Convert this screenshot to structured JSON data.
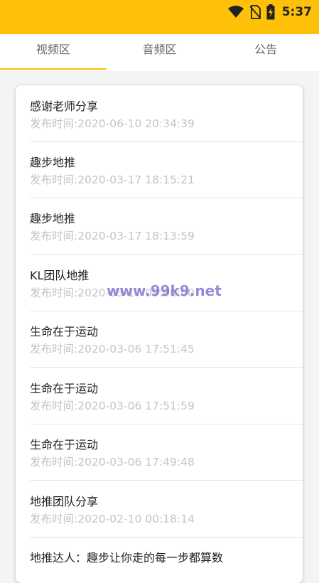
{
  "status_bar": {
    "time": "5:37",
    "icons": [
      "wifi-icon",
      "no-sim-icon",
      "battery-charging-icon"
    ],
    "background_color": "#ffc107"
  },
  "tabs": [
    {
      "label": "视频区",
      "active": true
    },
    {
      "label": "音频区",
      "active": false
    },
    {
      "label": "公告",
      "active": false
    }
  ],
  "accent_color": "#ffc107",
  "list": [
    {
      "title": "感谢老师分享",
      "time": "发布时间:2020-06-10 20:34:39"
    },
    {
      "title": "趣步地推",
      "time": "发布时间:2020-03-17 18:15:21"
    },
    {
      "title": "趣步地推",
      "time": "发布时间:2020-03-17 18:13:59"
    },
    {
      "title": "KL团队地推",
      "time": "发布时间:2020-03-17 09:00:00"
    },
    {
      "title": "生命在于运动",
      "time": "发布时间:2020-03-06 17:51:45"
    },
    {
      "title": "生命在于运动",
      "time": "发布时间:2020-03-06 17:51:59"
    },
    {
      "title": "生命在于运动",
      "time": "发布时间:2020-03-06 17:49:48"
    },
    {
      "title": "地推团队分享",
      "time": "发布时间:2020-02-10 00:18:14"
    },
    {
      "title": "地推达人：趣步让你走的每一步都算数",
      "time": ""
    }
  ],
  "watermark": "www.99k9.net"
}
